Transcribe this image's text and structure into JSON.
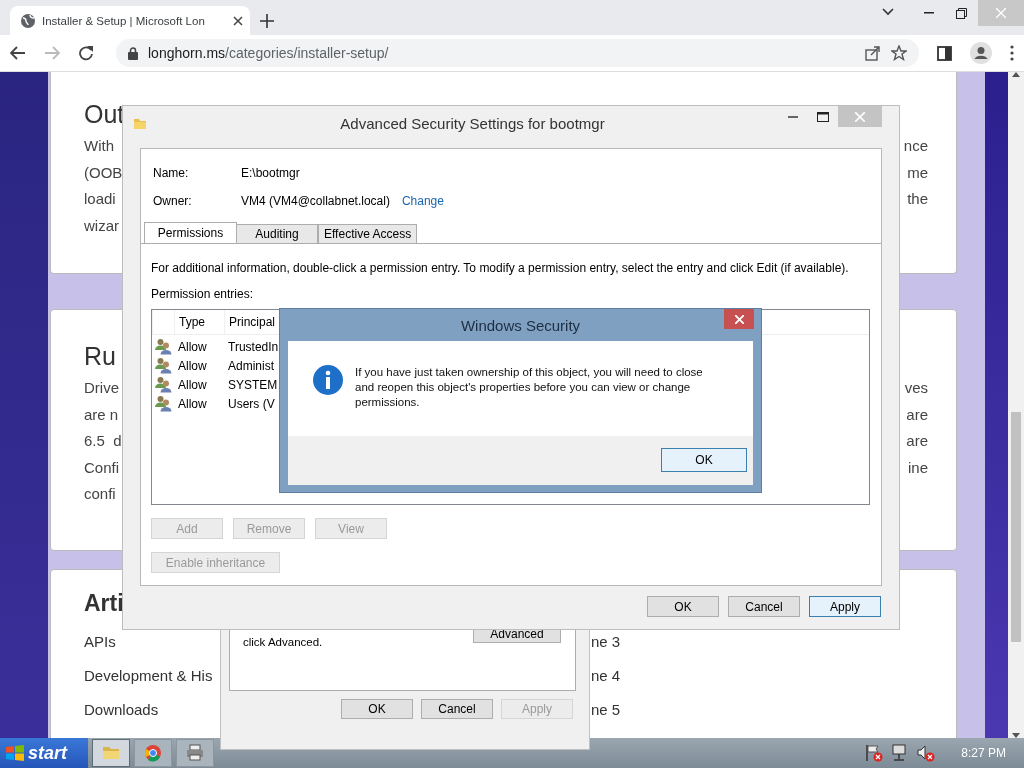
{
  "browser": {
    "tabs": [
      {
        "title": "Installer & Setup | Microsoft Lon",
        "selected": true
      }
    ],
    "forward_disabled": true,
    "address": {
      "host": "longhorn.ms",
      "path": "/categories/installer-setup/"
    }
  },
  "page": {
    "cards": [
      {
        "kind": "text",
        "heading": "Out",
        "lines": [
          {
            "left": "With",
            "right": "nce"
          },
          {
            "left": "(OOB",
            "right": "me"
          },
          {
            "left": "loadi",
            "right": "the"
          },
          {
            "left": "wizar"
          }
        ]
      },
      {
        "kind": "text",
        "heading": "Ru",
        "lines": [
          {
            "left": "Drive",
            "right": "ves"
          },
          {
            "left": "are n",
            "right": "are"
          },
          {
            "left": "6.5  d",
            "right": "are"
          },
          {
            "left": "Confi",
            "right": "ine"
          },
          {
            "left": "confi"
          }
        ]
      },
      {
        "kind": "links",
        "heading": "Arti",
        "lines": [
          {
            "left": "APIs",
            "right": "ne 3"
          },
          {
            "left": "Development & His",
            "right": "ne 4"
          },
          {
            "left": "Downloads",
            "right": "ne 5"
          }
        ]
      }
    ]
  },
  "back_dialog": {
    "note": "click Advanced.",
    "side_button": "Advanced",
    "buttons": [
      {
        "label": "OK",
        "disabled": false
      },
      {
        "label": "Cancel",
        "disabled": false
      },
      {
        "label": "Apply",
        "disabled": true
      }
    ]
  },
  "security_dialog": {
    "title": "Advanced Security Settings for bootmgr",
    "name_label": "Name:",
    "name": "E:\\bootmgr",
    "owner_label": "Owner:",
    "owner": "VM4 (VM4@collabnet.local)",
    "change_link": "Change",
    "tabs": [
      {
        "label": "Permissions",
        "selected": true
      },
      {
        "label": "Auditing",
        "selected": false
      },
      {
        "label": "Effective Access",
        "selected": false
      }
    ],
    "instructions": "For additional information, double-click a permission entry. To modify a permission entry, select the entry and click Edit (if available).",
    "entries_label": "Permission entries:",
    "columns": [
      "Type",
      "Principal"
    ],
    "entries": [
      {
        "type": "Allow",
        "principal": "TrustedIn"
      },
      {
        "type": "Allow",
        "principal": "Administ"
      },
      {
        "type": "Allow",
        "principal": "SYSTEM"
      },
      {
        "type": "Allow",
        "principal": "Users (V"
      }
    ],
    "list_buttons": [
      {
        "label": "Add",
        "disabled": true
      },
      {
        "label": "Remove",
        "disabled": true
      },
      {
        "label": "View",
        "disabled": true
      }
    ],
    "inheritance_button": {
      "label": "Enable inheritance",
      "disabled": true
    },
    "footer_buttons": [
      {
        "label": "OK",
        "focused": false
      },
      {
        "label": "Cancel",
        "focused": false
      },
      {
        "label": "Apply",
        "focused": true
      }
    ]
  },
  "message_box": {
    "title": "Windows Security",
    "message": "If you have just taken ownership of this object, you will need to close\nand reopen this object's properties before you can view or change\npermissions.",
    "buttons": [
      {
        "label": "OK",
        "focused": true
      }
    ]
  },
  "taskbar": {
    "start": "start",
    "apps": [
      {
        "kind": "folder",
        "active": true
      },
      {
        "kind": "browser",
        "active": false
      },
      {
        "kind": "printer",
        "active": false
      }
    ],
    "clock": "8:27 PM"
  }
}
